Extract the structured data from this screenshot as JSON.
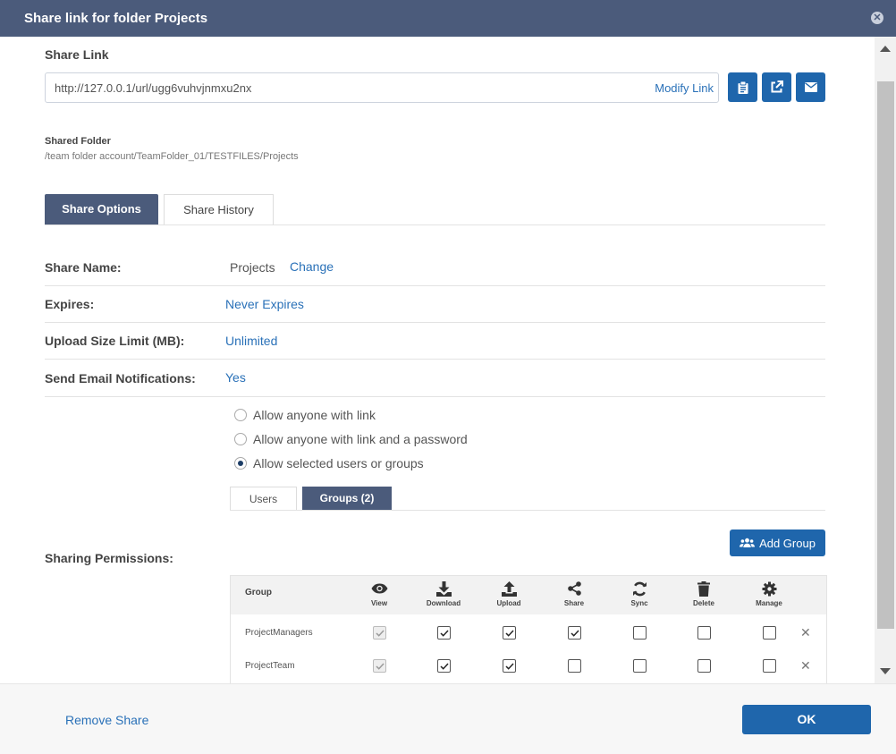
{
  "dialog": {
    "title": "Share link for folder Projects"
  },
  "share_link": {
    "label": "Share Link",
    "url": "http://127.0.0.1/url/ugg6vuhvjnmxu2nx",
    "modify_label": "Modify Link",
    "icons": [
      "clipboard-icon",
      "external-link-icon",
      "envelope-icon"
    ]
  },
  "shared_folder": {
    "label": "Shared Folder",
    "path": "/team folder account/TeamFolder_01/TESTFILES/Projects"
  },
  "tabs": [
    {
      "label": "Share Options",
      "active": true
    },
    {
      "label": "Share History",
      "active": false
    }
  ],
  "options": {
    "share_name": {
      "label": "Share Name:",
      "value": "Projects",
      "action": "Change"
    },
    "expires": {
      "label": "Expires:",
      "value": "Never Expires"
    },
    "upload_limit": {
      "label": "Upload Size Limit (MB):",
      "value": "Unlimited"
    },
    "email_notifications": {
      "label": "Send Email Notifications:",
      "value": "Yes"
    }
  },
  "access": {
    "options": [
      {
        "label": "Allow anyone with link",
        "selected": false
      },
      {
        "label": "Allow anyone with link and a password",
        "selected": false
      },
      {
        "label": "Allow selected users or groups",
        "selected": true
      }
    ]
  },
  "subtabs": [
    {
      "label": "Users",
      "active": false
    },
    {
      "label": "Groups (2)",
      "active": true
    }
  ],
  "permissions": {
    "label": "Sharing Permissions:",
    "add_group_label": "Add Group",
    "group_header": "Group",
    "columns": [
      {
        "label": "View",
        "icon": "eye-icon"
      },
      {
        "label": "Download",
        "icon": "download-icon"
      },
      {
        "label": "Upload",
        "icon": "upload-icon"
      },
      {
        "label": "Share",
        "icon": "share-icon"
      },
      {
        "label": "Sync",
        "icon": "sync-icon"
      },
      {
        "label": "Delete",
        "icon": "trash-icon"
      },
      {
        "label": "Manage",
        "icon": "gear-icon"
      }
    ],
    "rows": [
      {
        "name": "ProjectManagers",
        "checks": [
          true,
          true,
          true,
          true,
          false,
          false,
          false
        ]
      },
      {
        "name": "ProjectTeam",
        "checks": [
          true,
          true,
          true,
          false,
          false,
          false,
          false
        ]
      }
    ],
    "remove_symbol": "✕"
  },
  "footer": {
    "remove_label": "Remove Share",
    "ok_label": "OK"
  },
  "colors": {
    "header": "#4b5b7b",
    "primary": "#1f66ac",
    "link": "#2a71b8"
  }
}
